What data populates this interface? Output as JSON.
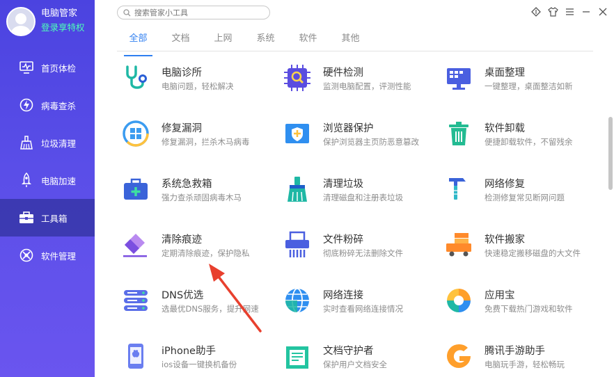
{
  "profile": {
    "name": "电脑管家",
    "vip_link": "登录享特权"
  },
  "sidebar": {
    "items": [
      {
        "label": "首页体检",
        "icon": "monitor-icon"
      },
      {
        "label": "病毒查杀",
        "icon": "lightning-shield-icon"
      },
      {
        "label": "垃圾清理",
        "icon": "broom-icon"
      },
      {
        "label": "电脑加速",
        "icon": "rocket-icon"
      },
      {
        "label": "工具箱",
        "icon": "toolbox-icon",
        "active": true
      },
      {
        "label": "软件管理",
        "icon": "apps-icon"
      }
    ]
  },
  "search": {
    "placeholder": "搜索管家小工具"
  },
  "tabs": [
    "全部",
    "文档",
    "上网",
    "系统",
    "软件",
    "其他"
  ],
  "active_tab": "全部",
  "tools": [
    {
      "title": "电脑诊所",
      "desc": "电脑问题，轻松解决",
      "icon": "stethoscope-icon"
    },
    {
      "title": "硬件检测",
      "desc": "监测电脑配置，评测性能",
      "icon": "chip-magnifier-icon"
    },
    {
      "title": "桌面整理",
      "desc": "一键整理，桌面整洁如新",
      "icon": "desktop-icon"
    },
    {
      "title": "修复漏洞",
      "desc": "修复漏洞，拦杀木马病毒",
      "icon": "windows-repair-icon"
    },
    {
      "title": "浏览器保护",
      "desc": "保护浏览器主页防恶意篡改",
      "icon": "browser-shield-icon"
    },
    {
      "title": "软件卸载",
      "desc": "便捷卸载软件，不留残余",
      "icon": "trash-icon"
    },
    {
      "title": "系统急救箱",
      "desc": "强力查杀顽固病毒木马",
      "icon": "first-aid-icon"
    },
    {
      "title": "清理垃圾",
      "desc": "清理磁盘和注册表垃圾",
      "icon": "cleaning-brush-icon"
    },
    {
      "title": "网络修复",
      "desc": "检测修复常见断网问题",
      "icon": "hammer-icon"
    },
    {
      "title": "清除痕迹",
      "desc": "定期清除痕迹，保护隐私",
      "icon": "eraser-icon"
    },
    {
      "title": "文件粉碎",
      "desc": "彻底粉碎无法删除文件",
      "icon": "shredder-icon"
    },
    {
      "title": "软件搬家",
      "desc": "快速稳定搬移磁盘的大文件",
      "icon": "truck-icon"
    },
    {
      "title": "DNS优选",
      "desc": "选最优DNS服务，提升网速",
      "icon": "server-icon"
    },
    {
      "title": "网络连接",
      "desc": "实时查看网络连接情况",
      "icon": "globe-icon"
    },
    {
      "title": "应用宝",
      "desc": "免费下载热门游戏和软件",
      "icon": "app-store-icon"
    },
    {
      "title": "iPhone助手",
      "desc": "ios设备一键换机备份",
      "icon": "iphone-icon"
    },
    {
      "title": "文档守护者",
      "desc": "保护用户文档安全",
      "icon": "document-icon"
    },
    {
      "title": "腾讯手游助手",
      "desc": "电脑玩手游，轻松畅玩",
      "icon": "game-assistant-icon"
    }
  ],
  "colors": {
    "accent": "#2f7ff0",
    "sidebar": "#5148e6",
    "annotation_arrow": "#e8402e"
  }
}
